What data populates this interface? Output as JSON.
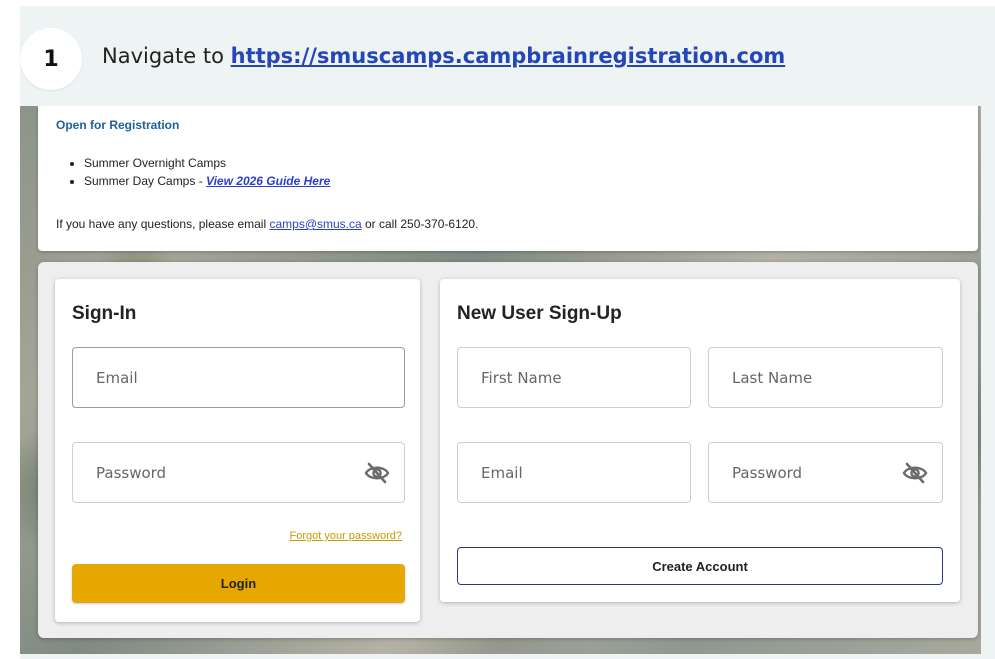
{
  "step": {
    "number": "1",
    "prefix": "Navigate to ",
    "link": "https://smuscamps.campbrainregistration.com"
  },
  "info": {
    "heading": "Open for Registration",
    "items": [
      {
        "text": "Summer Overnight Camps",
        "link": ""
      },
      {
        "text": "Summer Day Camps - ",
        "link": "View 2026 Guide Here"
      }
    ],
    "contact_prefix": "If you have any questions, please email ",
    "contact_email": "camps@smus.ca",
    "contact_suffix": " or call 250-370-6120."
  },
  "signin": {
    "title": "Sign-In",
    "email_placeholder": "Email",
    "password_placeholder": "Password",
    "forgot_label": "Forgot your password?",
    "login_label": "Login"
  },
  "signup": {
    "title": "New User Sign-Up",
    "first_name_placeholder": "First Name",
    "last_name_placeholder": "Last Name",
    "email_placeholder": "Email",
    "password_placeholder": "Password",
    "create_label": "Create Account"
  },
  "icons": {
    "password_toggle": "eye-slash-icon"
  },
  "colors": {
    "login_button": "#e6a800",
    "link": "#2446b8",
    "heading_blue": "#1f5f9a"
  }
}
